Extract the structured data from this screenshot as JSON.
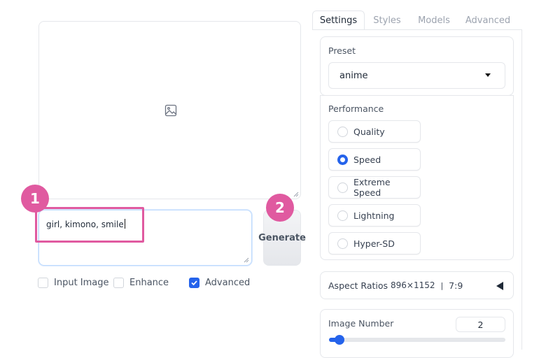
{
  "tabs": [
    {
      "label": "Settings",
      "active": true
    },
    {
      "label": "Styles",
      "active": false
    },
    {
      "label": "Models",
      "active": false
    },
    {
      "label": "Advanced",
      "active": false
    }
  ],
  "image_area": {
    "icon": "image-icon"
  },
  "prompt": {
    "value": "girl, kimono, smile"
  },
  "generate_label": "Generate",
  "callouts": {
    "one": "1",
    "two": "2"
  },
  "options": [
    {
      "label": "Input Image",
      "checked": false
    },
    {
      "label": "Enhance",
      "checked": false
    },
    {
      "label": "Advanced",
      "checked": true
    }
  ],
  "preset": {
    "label": "Preset",
    "value": "anime"
  },
  "performance": {
    "label": "Performance",
    "options": [
      {
        "label": "Quality",
        "selected": false
      },
      {
        "label": "Speed",
        "selected": true
      },
      {
        "label": "Extreme Speed",
        "selected": false
      },
      {
        "label": "Lightning",
        "selected": false
      },
      {
        "label": "Hyper-SD",
        "selected": false
      }
    ]
  },
  "aspect_ratios": {
    "label": "Aspect Ratios",
    "value": "896×1152",
    "separator": "|",
    "ratio": "7:9"
  },
  "image_number": {
    "label": "Image Number",
    "value": "2",
    "min": 1,
    "max": 32
  },
  "colors": {
    "accent": "#2563eb",
    "callout": "#e05aa0"
  }
}
